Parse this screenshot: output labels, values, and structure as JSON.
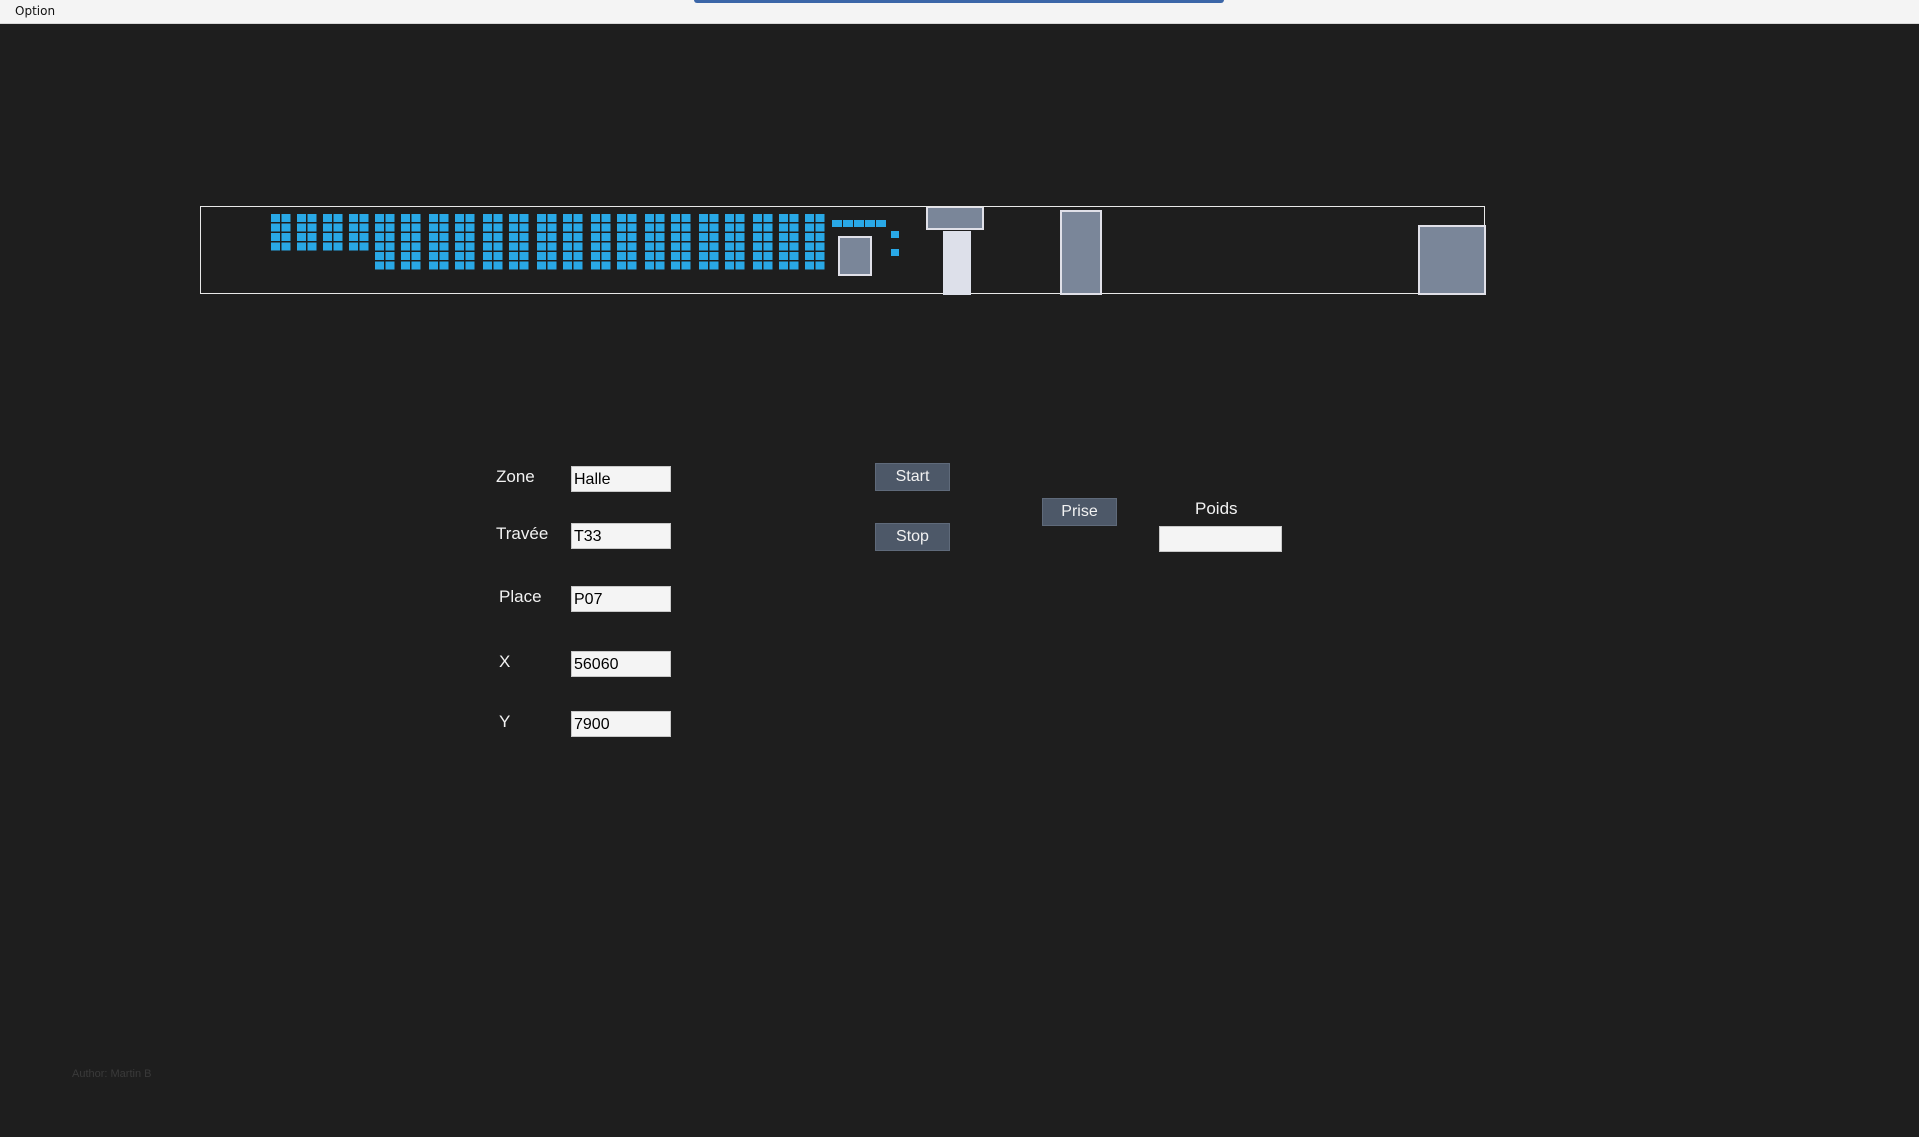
{
  "menu": {
    "option_label": "Option"
  },
  "form": {
    "zone": {
      "label": "Zone",
      "value": "Halle"
    },
    "travee": {
      "label": "Travée",
      "value": "T33"
    },
    "place": {
      "label": "Place",
      "value": "P07"
    },
    "x": {
      "label": "X",
      "value": "56060"
    },
    "y": {
      "label": "Y",
      "value": "7900"
    }
  },
  "controls": {
    "start_label": "Start",
    "stop_label": "Stop",
    "prise_label": "Prise",
    "poids_label": "Poids",
    "poids_value": ""
  },
  "footer": {
    "author": "Author: Martin B"
  },
  "colors": {
    "background": "#1e1e1e",
    "slot": "#29a8e6",
    "equipment": "#7a8699",
    "equipment_border": "#e0e0e8",
    "button": "#4d5868"
  }
}
